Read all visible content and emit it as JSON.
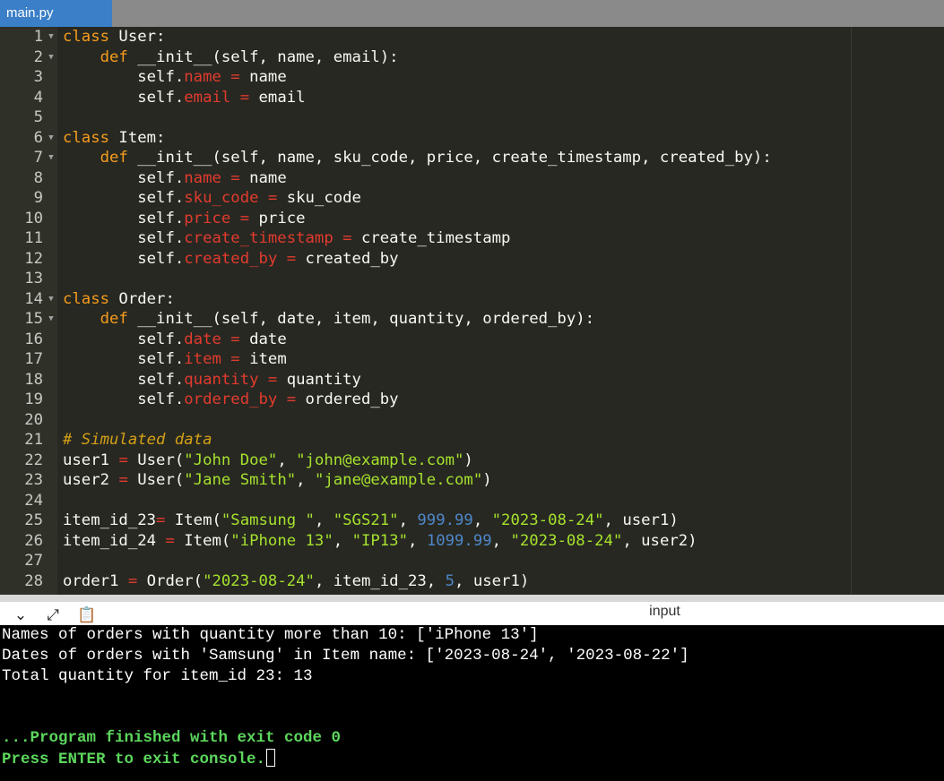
{
  "tab": {
    "filename": "main.py"
  },
  "editor": {
    "lines": [
      {
        "n": "1",
        "fold": true
      },
      {
        "n": "2",
        "fold": true
      },
      {
        "n": "3"
      },
      {
        "n": "4"
      },
      {
        "n": "5"
      },
      {
        "n": "6",
        "fold": true
      },
      {
        "n": "7",
        "fold": true
      },
      {
        "n": "8"
      },
      {
        "n": "9"
      },
      {
        "n": "10"
      },
      {
        "n": "11"
      },
      {
        "n": "12"
      },
      {
        "n": "13"
      },
      {
        "n": "14",
        "fold": true
      },
      {
        "n": "15",
        "fold": true
      },
      {
        "n": "16"
      },
      {
        "n": "17"
      },
      {
        "n": "18"
      },
      {
        "n": "19"
      },
      {
        "n": "20"
      },
      {
        "n": "21"
      },
      {
        "n": "22"
      },
      {
        "n": "23"
      },
      {
        "n": "24"
      },
      {
        "n": "25"
      },
      {
        "n": "26"
      },
      {
        "n": "27"
      },
      {
        "n": "28"
      }
    ],
    "code": {
      "l1": [
        "class",
        " User:"
      ],
      "l2": [
        "def",
        " __init__(self, name, email):"
      ],
      "l3": [
        "self.",
        "name",
        " = ",
        "name"
      ],
      "l4": [
        "self.",
        "email",
        " = ",
        "email"
      ],
      "l6": [
        "class",
        " Item:"
      ],
      "l7": [
        "def",
        " __init__(self, name, sku_code, price, create_timestamp, created_by):"
      ],
      "l8": [
        "self.",
        "name",
        " = ",
        "name"
      ],
      "l9": [
        "self.",
        "sku_code",
        " = ",
        "sku_code"
      ],
      "l10": [
        "self.",
        "price",
        " = ",
        "price"
      ],
      "l11": [
        "self.",
        "create_timestamp",
        " = ",
        "create_timestamp"
      ],
      "l12": [
        "self.",
        "created_by",
        " = ",
        "created_by"
      ],
      "l14": [
        "class",
        " Order:"
      ],
      "l15": [
        "def",
        " __init__(self, date, item, quantity, ordered_by):"
      ],
      "l16": [
        "self.",
        "date",
        " = ",
        "date"
      ],
      "l17": [
        "self.",
        "item",
        " = ",
        "item"
      ],
      "l18": [
        "self.",
        "quantity",
        " = ",
        "quantity"
      ],
      "l19": [
        "self.",
        "ordered_by",
        " = ",
        "ordered_by"
      ],
      "l21": "# Simulated data",
      "l22": [
        "user1 ",
        "=",
        " User(",
        "\"John Doe\"",
        ", ",
        "\"john@example.com\"",
        ")"
      ],
      "l23": [
        "user2 ",
        "=",
        " User(",
        "\"Jane Smith\"",
        ", ",
        "\"jane@example.com\"",
        ")"
      ],
      "l25": [
        "item_id_23",
        "=",
        " Item(",
        "\"Samsung \"",
        ", ",
        "\"SGS21\"",
        ", ",
        "999.99",
        ", ",
        "\"2023-08-24\"",
        ", user1)"
      ],
      "l26": [
        "item_id_24 ",
        "=",
        " Item(",
        "\"iPhone 13\"",
        ", ",
        "\"IP13\"",
        ", ",
        "1099.99",
        ", ",
        "\"2023-08-24\"",
        ", user2)"
      ],
      "l28": [
        "order1 ",
        "=",
        " Order(",
        "\"2023-08-24\"",
        ", item_id_23, ",
        "5",
        ", user1)"
      ]
    }
  },
  "console_bar": {
    "title": "input",
    "icons": [
      "chevron-down-icon",
      "expand-icon",
      "clipboard-icon"
    ]
  },
  "console": {
    "out1": "Names of orders with quantity more than 10: ['iPhone 13']",
    "out2": "Dates of orders with 'Samsung' in Item name: ['2023-08-24', '2023-08-22']",
    "out3": "Total quantity for item_id 23: 13",
    "finished": "...Program finished with exit code 0",
    "press": "Press ENTER to exit console."
  },
  "colors": {
    "tab_active": "#3a7fc7",
    "keyword": "#f59c1c",
    "attribute": "#e23b2e",
    "string": "#a6e22e",
    "number": "#4e86c8",
    "console_green": "#5cd65c"
  }
}
